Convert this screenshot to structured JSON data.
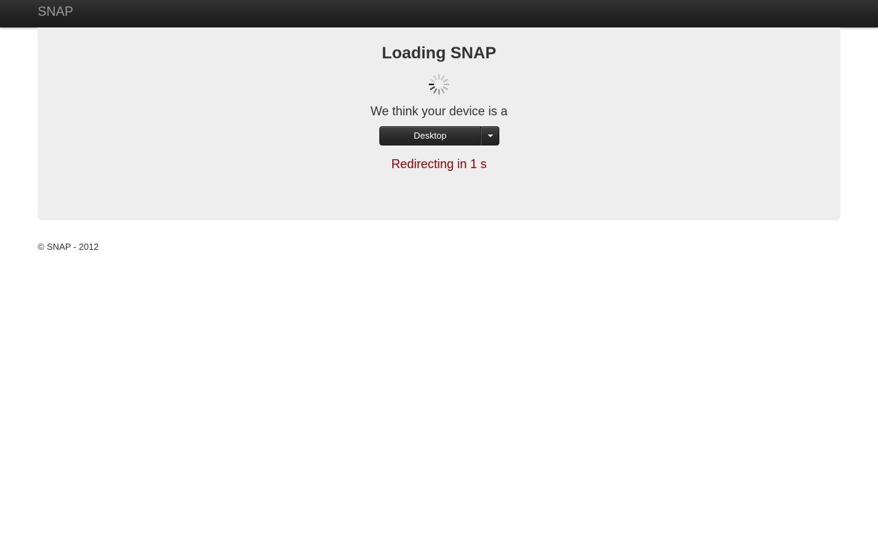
{
  "navbar": {
    "brand": "SNAP",
    "background": "#222222",
    "brand_color": "#999999"
  },
  "hero": {
    "title": "Loading SNAP",
    "spinner_icon": "loading-spinner-icon",
    "device_text": "We think your device is a",
    "device_select": {
      "selected": "Desktop",
      "caret_icon": "caret-down-icon"
    },
    "redirect_text": "Redirecting in 1 s",
    "redirect_color": "#8b0000",
    "background": "#eeeeee"
  },
  "footer": {
    "copyright": "© SNAP - 2012"
  }
}
